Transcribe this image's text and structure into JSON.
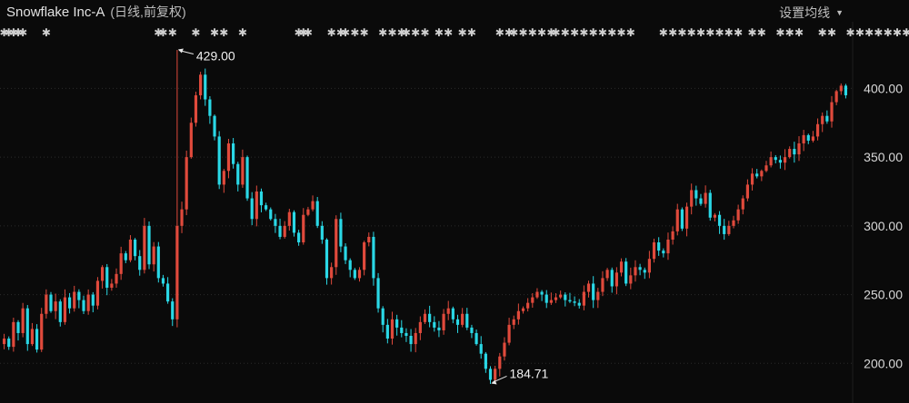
{
  "header": {
    "title": "Snowflake Inc-A",
    "subtitle": "(日线,前复权)",
    "setting_label": "设置均线"
  },
  "colors": {
    "background": "#0a0a0a",
    "up": "#e04a3c",
    "down": "#2ad8e6",
    "grid": "#2a2a2a",
    "marker": "#d0d0d0"
  },
  "chart_data": {
    "type": "candlestick",
    "title": "Snowflake Inc-A",
    "subtitle": "(日线,前复权)",
    "ylim": [
      185,
      428
    ],
    "yticks": [
      200,
      250,
      300,
      350,
      400
    ],
    "ytick_labels": [
      "200.00",
      "250.00",
      "300.00",
      "350.00",
      "400.00"
    ],
    "grid": true,
    "annotations": [
      {
        "label": "429.00",
        "value": 429.0,
        "index": 37
      },
      {
        "label": "184.71",
        "value": 184.71,
        "index": 104
      }
    ],
    "event_markers": [
      0,
      1,
      2,
      3,
      4,
      9,
      33,
      34,
      36,
      41,
      45,
      47,
      51,
      63,
      64,
      65,
      70,
      72,
      73,
      75,
      77,
      81,
      83,
      85,
      86,
      88,
      90,
      93,
      95,
      98,
      100,
      106,
      108,
      109,
      111,
      113,
      115,
      117,
      118,
      120,
      122,
      124,
      126,
      128,
      130,
      132,
      134,
      141,
      143,
      145,
      147,
      149,
      151,
      153,
      155,
      157,
      160,
      162,
      166,
      168,
      170,
      175,
      177,
      181,
      183,
      185,
      187,
      189,
      191,
      193
    ],
    "closes": [
      218,
      212,
      230,
      222,
      240,
      214,
      225,
      210,
      236,
      250,
      238,
      245,
      230,
      248,
      240,
      252,
      246,
      238,
      250,
      242,
      260,
      270,
      255,
      258,
      265,
      280,
      275,
      290,
      278,
      268,
      300,
      272,
      285,
      262,
      258,
      245,
      232,
      300,
      312,
      350,
      375,
      395,
      410,
      392,
      380,
      365,
      330,
      340,
      360,
      345,
      330,
      350,
      320,
      305,
      325,
      315,
      312,
      305,
      300,
      292,
      300,
      310,
      295,
      288,
      308,
      312,
      318,
      300,
      290,
      262,
      270,
      305,
      285,
      275,
      268,
      262,
      268,
      288,
      292,
      262,
      240,
      228,
      218,
      232,
      226,
      222,
      220,
      214,
      222,
      230,
      236,
      230,
      226,
      224,
      236,
      240,
      232,
      228,
      236,
      226,
      222,
      214,
      207,
      196,
      188,
      196,
      205,
      215,
      228,
      232,
      238,
      240,
      244,
      248,
      252,
      250,
      244,
      246,
      248,
      250,
      246,
      245,
      244,
      242,
      252,
      258,
      246,
      252,
      262,
      268,
      256,
      266,
      274,
      258,
      264,
      270,
      268,
      266,
      276,
      288,
      282,
      280,
      290,
      296,
      312,
      298,
      314,
      326,
      320,
      316,
      324,
      306,
      308,
      300,
      294,
      300,
      304,
      312,
      320,
      330,
      338,
      336,
      340,
      344,
      350,
      348,
      346,
      350,
      356,
      352,
      360,
      366,
      362,
      365,
      374,
      380,
      376,
      390,
      398,
      402,
      395
    ]
  }
}
